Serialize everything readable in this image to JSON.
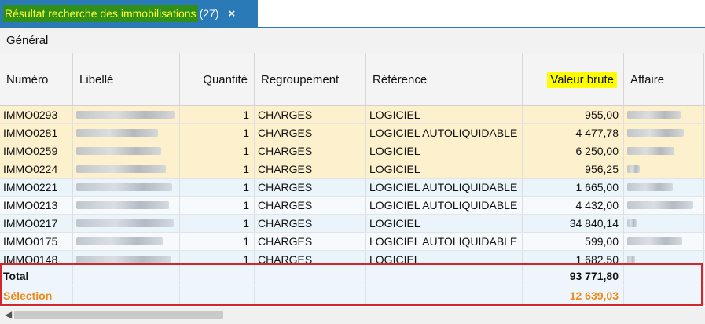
{
  "tab": {
    "title": "Résultat recherche des immobilisations",
    "count": "(27)",
    "close": "×"
  },
  "section": {
    "label": "Général"
  },
  "columns": [
    {
      "key": "numero",
      "label": "Numéro"
    },
    {
      "key": "libelle",
      "label": "Libellé"
    },
    {
      "key": "quantite",
      "label": "Quantité"
    },
    {
      "key": "regroupement",
      "label": "Regroupement"
    },
    {
      "key": "reference",
      "label": "Référence"
    },
    {
      "key": "valeur",
      "label": "Valeur brute"
    },
    {
      "key": "affaire",
      "label": "Affaire"
    }
  ],
  "rows": [
    {
      "numero": "IMMO0293",
      "quantite": "1",
      "regroupement": "CHARGES",
      "reference": "LOGICIEL",
      "valeur": "955,00",
      "selected": true
    },
    {
      "numero": "IMMO0281",
      "quantite": "1",
      "regroupement": "CHARGES",
      "reference": "LOGICIEL AUTOLIQUIDABLE",
      "valeur": "4 477,78",
      "selected": true
    },
    {
      "numero": "IMMO0259",
      "quantite": "1",
      "regroupement": "CHARGES",
      "reference": "LOGICIEL",
      "valeur": "6 250,00",
      "selected": true
    },
    {
      "numero": "IMMO0224",
      "quantite": "1",
      "regroupement": "CHARGES",
      "reference": "LOGICIEL",
      "valeur": "956,25",
      "selected": true
    },
    {
      "numero": "IMMO0221",
      "quantite": "1",
      "regroupement": "CHARGES",
      "reference": "LOGICIEL AUTOLIQUIDABLE",
      "valeur": "1 665,00",
      "selected": false
    },
    {
      "numero": "IMMO0213",
      "quantite": "1",
      "regroupement": "CHARGES",
      "reference": "LOGICIEL AUTOLIQUIDABLE",
      "valeur": "4 432,00",
      "selected": false
    },
    {
      "numero": "IMMO0217",
      "quantite": "1",
      "regroupement": "CHARGES",
      "reference": "LOGICIEL",
      "valeur": "34 840,14",
      "selected": false
    },
    {
      "numero": "IMMO0175",
      "quantite": "1",
      "regroupement": "CHARGES",
      "reference": "LOGICIEL AUTOLIQUIDABLE",
      "valeur": "599,00",
      "selected": false
    },
    {
      "numero": "IMMO0148",
      "quantite": "1",
      "regroupement": "CHARGES",
      "reference": "LOGICIEL",
      "valeur": "1 682,50",
      "selected": false
    }
  ],
  "totals": {
    "total_label": "Total",
    "total_value": "93 771,80",
    "selection_label": "Sélection",
    "selection_value": "12 639,03"
  },
  "colors": {
    "accent": "#2a7ab8",
    "tab_title_bg": "#2f8f18",
    "highlight": "#ffff00",
    "selected_row": "#fdf0cc",
    "selection_text": "#ee8a17",
    "red_box": "#d3272b"
  },
  "icons": {
    "close": "close-icon",
    "scroll_left": "chevron-left-icon"
  }
}
